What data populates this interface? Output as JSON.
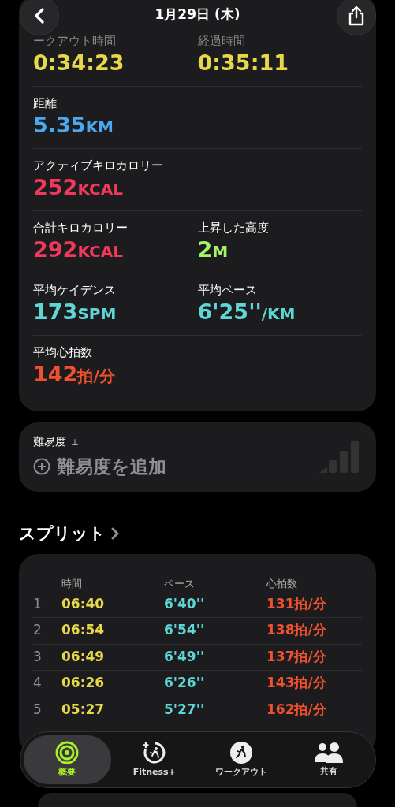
{
  "header": {
    "title": "1月29日 (木)"
  },
  "metrics": [
    {
      "cells": [
        {
          "label": "ークアウト時間",
          "value": "0:34:23",
          "color": "#e6d84a"
        },
        {
          "label": "経過時間",
          "value": "0:35:11",
          "color": "#e6d84a"
        }
      ]
    },
    {
      "cells": [
        {
          "label": "距離",
          "value": "5.35",
          "unit": "KM",
          "color": "#4aa8f0"
        }
      ]
    },
    {
      "cells": [
        {
          "label": "アクティブキロカロリー",
          "value": "252",
          "unit": "KCAL",
          "color": "#f0385a"
        }
      ]
    },
    {
      "cells": [
        {
          "label": "合計キロカロリー",
          "value": "292",
          "unit": "KCAL",
          "color": "#f0385a"
        },
        {
          "label": "上昇した高度",
          "value": "2",
          "unit": "M",
          "color": "#a4f56a"
        }
      ]
    },
    {
      "cells": [
        {
          "label": "平均ケイデンス",
          "value": "173",
          "unit": "SPM",
          "color": "#5fd6d6"
        },
        {
          "label": "平均ペース",
          "value": "6'25''",
          "unit": "/KM",
          "color": "#5fd6d6"
        }
      ]
    },
    {
      "cells": [
        {
          "label": "平均心拍数",
          "value": "142",
          "unit": "拍/分",
          "color": "#f0502e"
        }
      ]
    }
  ],
  "difficulty": {
    "label": "難易度",
    "mark": "±",
    "action": "難易度を追加"
  },
  "splits": {
    "title": "スプリット",
    "columns": [
      "時間",
      "ペース",
      "心拍数"
    ],
    "rows": [
      {
        "index": "1",
        "time": "06:40",
        "pace": "6'40''",
        "heart_rate": "131拍/分"
      },
      {
        "index": "2",
        "time": "06:54",
        "pace": "6'54''",
        "heart_rate": "138拍/分"
      },
      {
        "index": "3",
        "time": "06:49",
        "pace": "6'49''",
        "heart_rate": "137拍/分"
      },
      {
        "index": "4",
        "time": "06:26",
        "pace": "6'26''",
        "heart_rate": "143拍/分"
      },
      {
        "index": "5",
        "time": "05:27",
        "pace": "5'27''",
        "heart_rate": "162拍/分"
      }
    ]
  },
  "tabs": [
    {
      "label": "概要",
      "kind": "summary",
      "selected": true
    },
    {
      "label": "Fitness+",
      "kind": "fitness",
      "selected": false
    },
    {
      "label": "ワークアウト",
      "kind": "workout",
      "selected": false
    },
    {
      "label": "共有",
      "kind": "sharing",
      "selected": false
    }
  ]
}
